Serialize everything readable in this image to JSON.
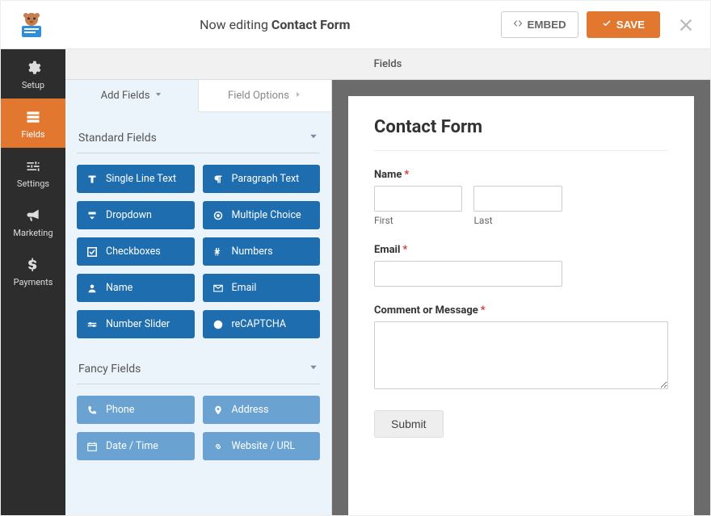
{
  "topbar": {
    "editing_prefix": "Now editing",
    "editing_name": "Contact Form",
    "embed_label": "EMBED",
    "save_label": "SAVE"
  },
  "sidebar": {
    "items": [
      {
        "label": "Setup"
      },
      {
        "label": "Fields"
      },
      {
        "label": "Settings"
      },
      {
        "label": "Marketing"
      },
      {
        "label": "Payments"
      }
    ],
    "active_index": 1
  },
  "panel_title": "Fields",
  "tabs": {
    "add": "Add Fields",
    "options": "Field Options"
  },
  "groups": {
    "standard": {
      "title": "Standard Fields",
      "items": [
        "Single Line Text",
        "Paragraph Text",
        "Dropdown",
        "Multiple Choice",
        "Checkboxes",
        "Numbers",
        "Name",
        "Email",
        "Number Slider",
        "reCAPTCHA"
      ]
    },
    "fancy": {
      "title": "Fancy Fields",
      "items": [
        "Phone",
        "Address",
        "Date / Time",
        "Website / URL"
      ]
    }
  },
  "form": {
    "title": "Contact Form",
    "name_label": "Name",
    "first_label": "First",
    "last_label": "Last",
    "email_label": "Email",
    "comment_label": "Comment or Message",
    "submit_label": "Submit"
  }
}
